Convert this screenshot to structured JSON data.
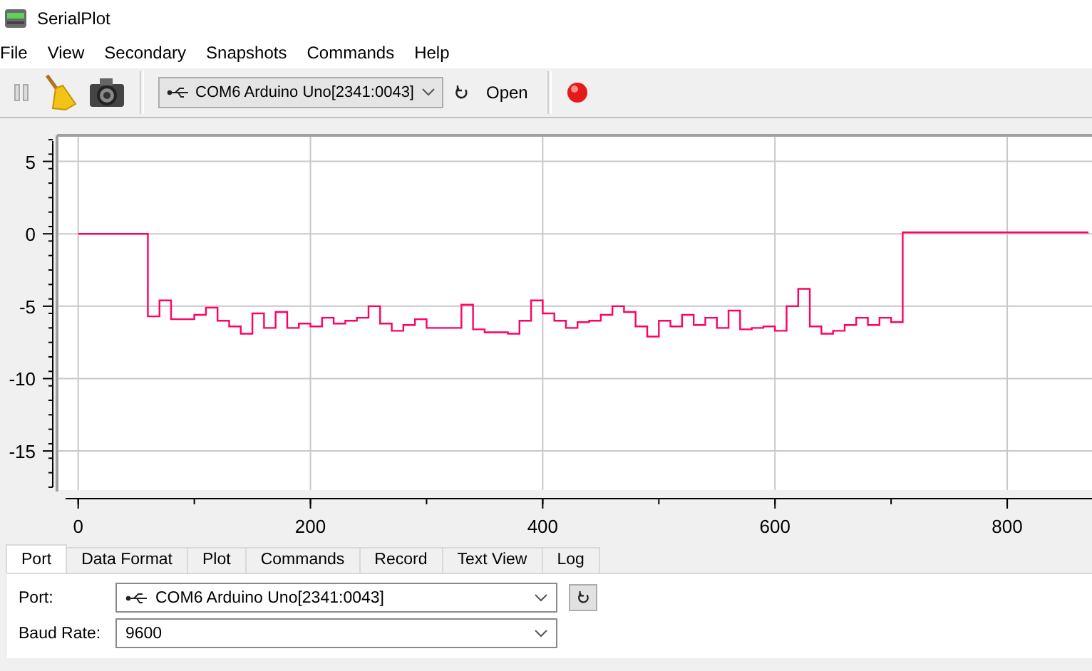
{
  "window": {
    "title": "SerialPlot"
  },
  "menu": [
    "File",
    "View",
    "Secondary",
    "Snapshots",
    "Commands",
    "Help"
  ],
  "toolbar": {
    "port": "COM6 Arduino Uno[2341:0043]",
    "open_button": "Open"
  },
  "plot": {
    "chart_data": {
      "type": "line",
      "xlim": [
        -17,
        873
      ],
      "ylim": [
        -17.7,
        6.8
      ],
      "xticks": [
        0,
        200,
        400,
        600,
        800
      ],
      "yticks": [
        5,
        0,
        -5,
        -10,
        -15
      ],
      "grid": true,
      "x": [
        0,
        60,
        60,
        70,
        70,
        80,
        80,
        100,
        100,
        110,
        110,
        120,
        120,
        130,
        130,
        140,
        140,
        150,
        150,
        160,
        160,
        170,
        170,
        180,
        180,
        190,
        190,
        200,
        200,
        210,
        210,
        220,
        220,
        230,
        230,
        240,
        240,
        250,
        250,
        260,
        260,
        270,
        270,
        280,
        280,
        290,
        290,
        300,
        300,
        330,
        330,
        340,
        340,
        350,
        350,
        370,
        370,
        380,
        380,
        390,
        390,
        400,
        400,
        410,
        410,
        420,
        420,
        430,
        430,
        440,
        440,
        450,
        450,
        460,
        460,
        470,
        470,
        480,
        480,
        490,
        490,
        500,
        500,
        510,
        510,
        520,
        520,
        530,
        530,
        540,
        540,
        550,
        550,
        560,
        560,
        570,
        570,
        580,
        580,
        590,
        590,
        600,
        600,
        610,
        610,
        620,
        620,
        630,
        630,
        640,
        640,
        650,
        650,
        660,
        660,
        670,
        670,
        680,
        680,
        690,
        690,
        700,
        700,
        710,
        710,
        870
      ],
      "series": [
        {
          "color": "#ff0066",
          "values": [
            0,
            0,
            -5.7,
            -5.7,
            -4.6,
            -4.6,
            -5.9,
            -5.9,
            -5.6,
            -5.6,
            -5.1,
            -5.1,
            -6.0,
            -6.0,
            -6.4,
            -6.4,
            -6.9,
            -6.9,
            -5.5,
            -5.5,
            -6.5,
            -6.5,
            -5.4,
            -5.4,
            -6.5,
            -6.5,
            -6.2,
            -6.2,
            -6.4,
            -6.4,
            -5.8,
            -5.8,
            -6.2,
            -6.2,
            -6.0,
            -6.0,
            -5.8,
            -5.8,
            -5.0,
            -5.0,
            -6.2,
            -6.2,
            -6.7,
            -6.7,
            -6.3,
            -6.3,
            -5.9,
            -5.9,
            -6.5,
            -6.5,
            -4.9,
            -4.9,
            -6.6,
            -6.6,
            -6.8,
            -6.8,
            -6.9,
            -6.9,
            -6.0,
            -6.0,
            -4.6,
            -4.6,
            -5.5,
            -5.5,
            -6.0,
            -6.0,
            -6.5,
            -6.5,
            -6.1,
            -6.1,
            -6.0,
            -6.0,
            -5.6,
            -5.6,
            -5.0,
            -5.0,
            -5.4,
            -5.4,
            -6.4,
            -6.4,
            -7.1,
            -7.1,
            -6.0,
            -6.0,
            -6.4,
            -6.4,
            -5.6,
            -5.6,
            -6.3,
            -6.3,
            -5.8,
            -5.8,
            -6.5,
            -6.5,
            -5.3,
            -5.3,
            -6.6,
            -6.6,
            -6.5,
            -6.5,
            -6.4,
            -6.4,
            -6.7,
            -6.7,
            -5.0,
            -5.0,
            -3.8,
            -3.8,
            -6.4,
            -6.4,
            -6.9,
            -6.9,
            -6.7,
            -6.7,
            -6.3,
            -6.3,
            -5.8,
            -5.8,
            -6.3,
            -6.3,
            -5.8,
            -5.8,
            -6.1,
            -6.1,
            0.1,
            0.1
          ]
        }
      ]
    }
  },
  "tabs": [
    {
      "label": "Port",
      "selected": true
    },
    {
      "label": "Data Format",
      "selected": false
    },
    {
      "label": "Plot",
      "selected": false
    },
    {
      "label": "Commands",
      "selected": false
    },
    {
      "label": "Record",
      "selected": false
    },
    {
      "label": "Text View",
      "selected": false
    },
    {
      "label": "Log",
      "selected": false
    }
  ],
  "port_panel": {
    "port_label": "Port:",
    "port_value": "COM6 Arduino Uno[2341:0043]",
    "baud_label": "Baud Rate:",
    "baud_value": "9600"
  }
}
